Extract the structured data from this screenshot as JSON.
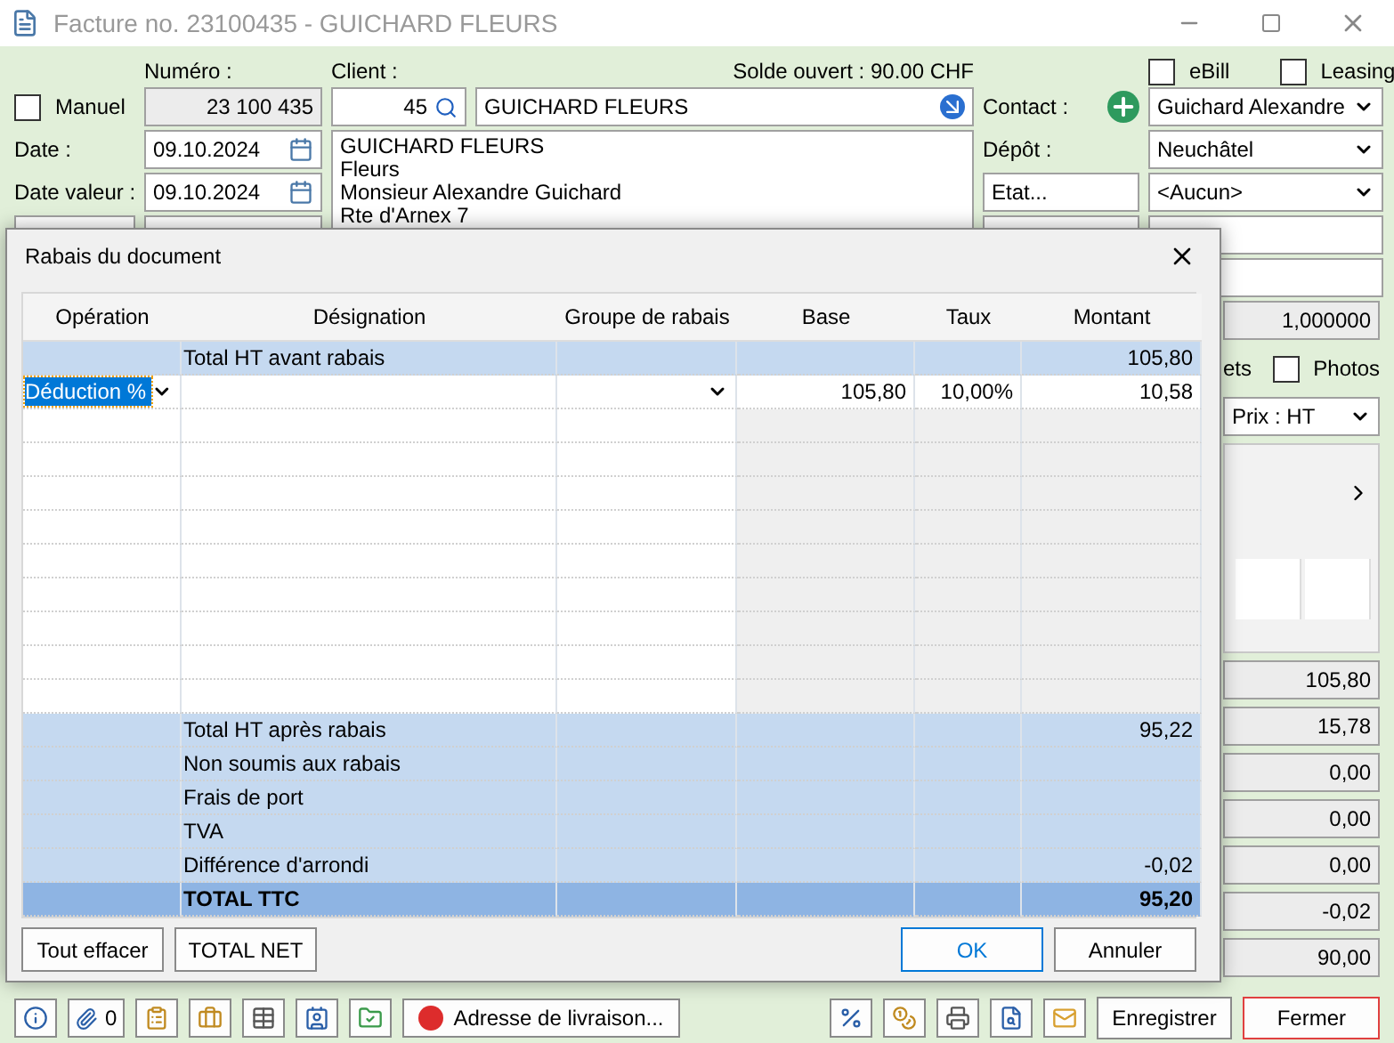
{
  "window": {
    "title": "Facture no. 23100435 - GUICHARD FLEURS"
  },
  "header": {
    "numero_label": "Numéro :",
    "client_label": "Client :",
    "solde": "Solde ouvert : 90.00 CHF",
    "ebill": {
      "label": "eBill",
      "checked": false
    },
    "leasing": {
      "label": "Leasing",
      "checked": false
    },
    "manuel": {
      "label": "Manuel",
      "checked": false
    },
    "numero": "23 100 435",
    "client_number": "45",
    "client_name": "GUICHARD FLEURS",
    "contact_label": "Contact :",
    "contact": "Guichard Alexandre",
    "date_label": "Date :",
    "date": "09.10.2024",
    "address_lines": [
      "GUICHARD FLEURS",
      "Fleurs",
      "Monsieur Alexandre Guichard",
      "Rte d'Arnex 7"
    ],
    "depot_label": "Dépôt :",
    "depot": "Neuchâtel",
    "date_valeur_label": "Date valeur :",
    "date_valeur": "09.10.2024",
    "etat_button": "Etat...",
    "etat": "<Aucun>"
  },
  "right_panel": {
    "rate": "1,000000",
    "partial_label": "ets",
    "photos": {
      "label": "Photos",
      "checked": false
    },
    "price_mode": "Prix : HT",
    "totals": [
      "105,80",
      "15,78",
      "0,00",
      "0,00",
      "0,00",
      "-0,02",
      "90,00"
    ]
  },
  "toolbar": {
    "attachments": "0",
    "delivery_button": "Adresse de livraison...",
    "save_button": "Enregistrer",
    "close_button": "Fermer"
  },
  "dialog": {
    "title": "Rabais du document",
    "columns": [
      "Opération",
      "Désignation",
      "Groupe de rabais",
      "Base",
      "Taux",
      "Montant"
    ],
    "rows": [
      {
        "kind": "summary",
        "designation": "Total HT avant rabais",
        "montant": "105,80"
      },
      {
        "kind": "entry",
        "operation": "Déduction %",
        "selected": true,
        "base": "105,80",
        "taux": "10,00%",
        "montant": "10,58"
      },
      {
        "kind": "empty"
      },
      {
        "kind": "empty"
      },
      {
        "kind": "empty"
      },
      {
        "kind": "empty"
      },
      {
        "kind": "empty"
      },
      {
        "kind": "empty"
      },
      {
        "kind": "empty"
      },
      {
        "kind": "empty"
      },
      {
        "kind": "empty"
      },
      {
        "kind": "summary",
        "designation": "Total HT après rabais",
        "montant": "95,22"
      },
      {
        "kind": "summary",
        "designation": "Non soumis aux rabais"
      },
      {
        "kind": "summary",
        "designation": "Frais de port"
      },
      {
        "kind": "summary",
        "designation": "TVA"
      },
      {
        "kind": "summary",
        "designation": "Différence d'arrondi",
        "montant": "-0,02"
      },
      {
        "kind": "total",
        "designation": "TOTAL TTC",
        "montant": "95,20"
      }
    ],
    "left_buttons": [
      "Tout effacer",
      "TOTAL NET"
    ],
    "ok": "OK",
    "cancel": "Annuler"
  }
}
